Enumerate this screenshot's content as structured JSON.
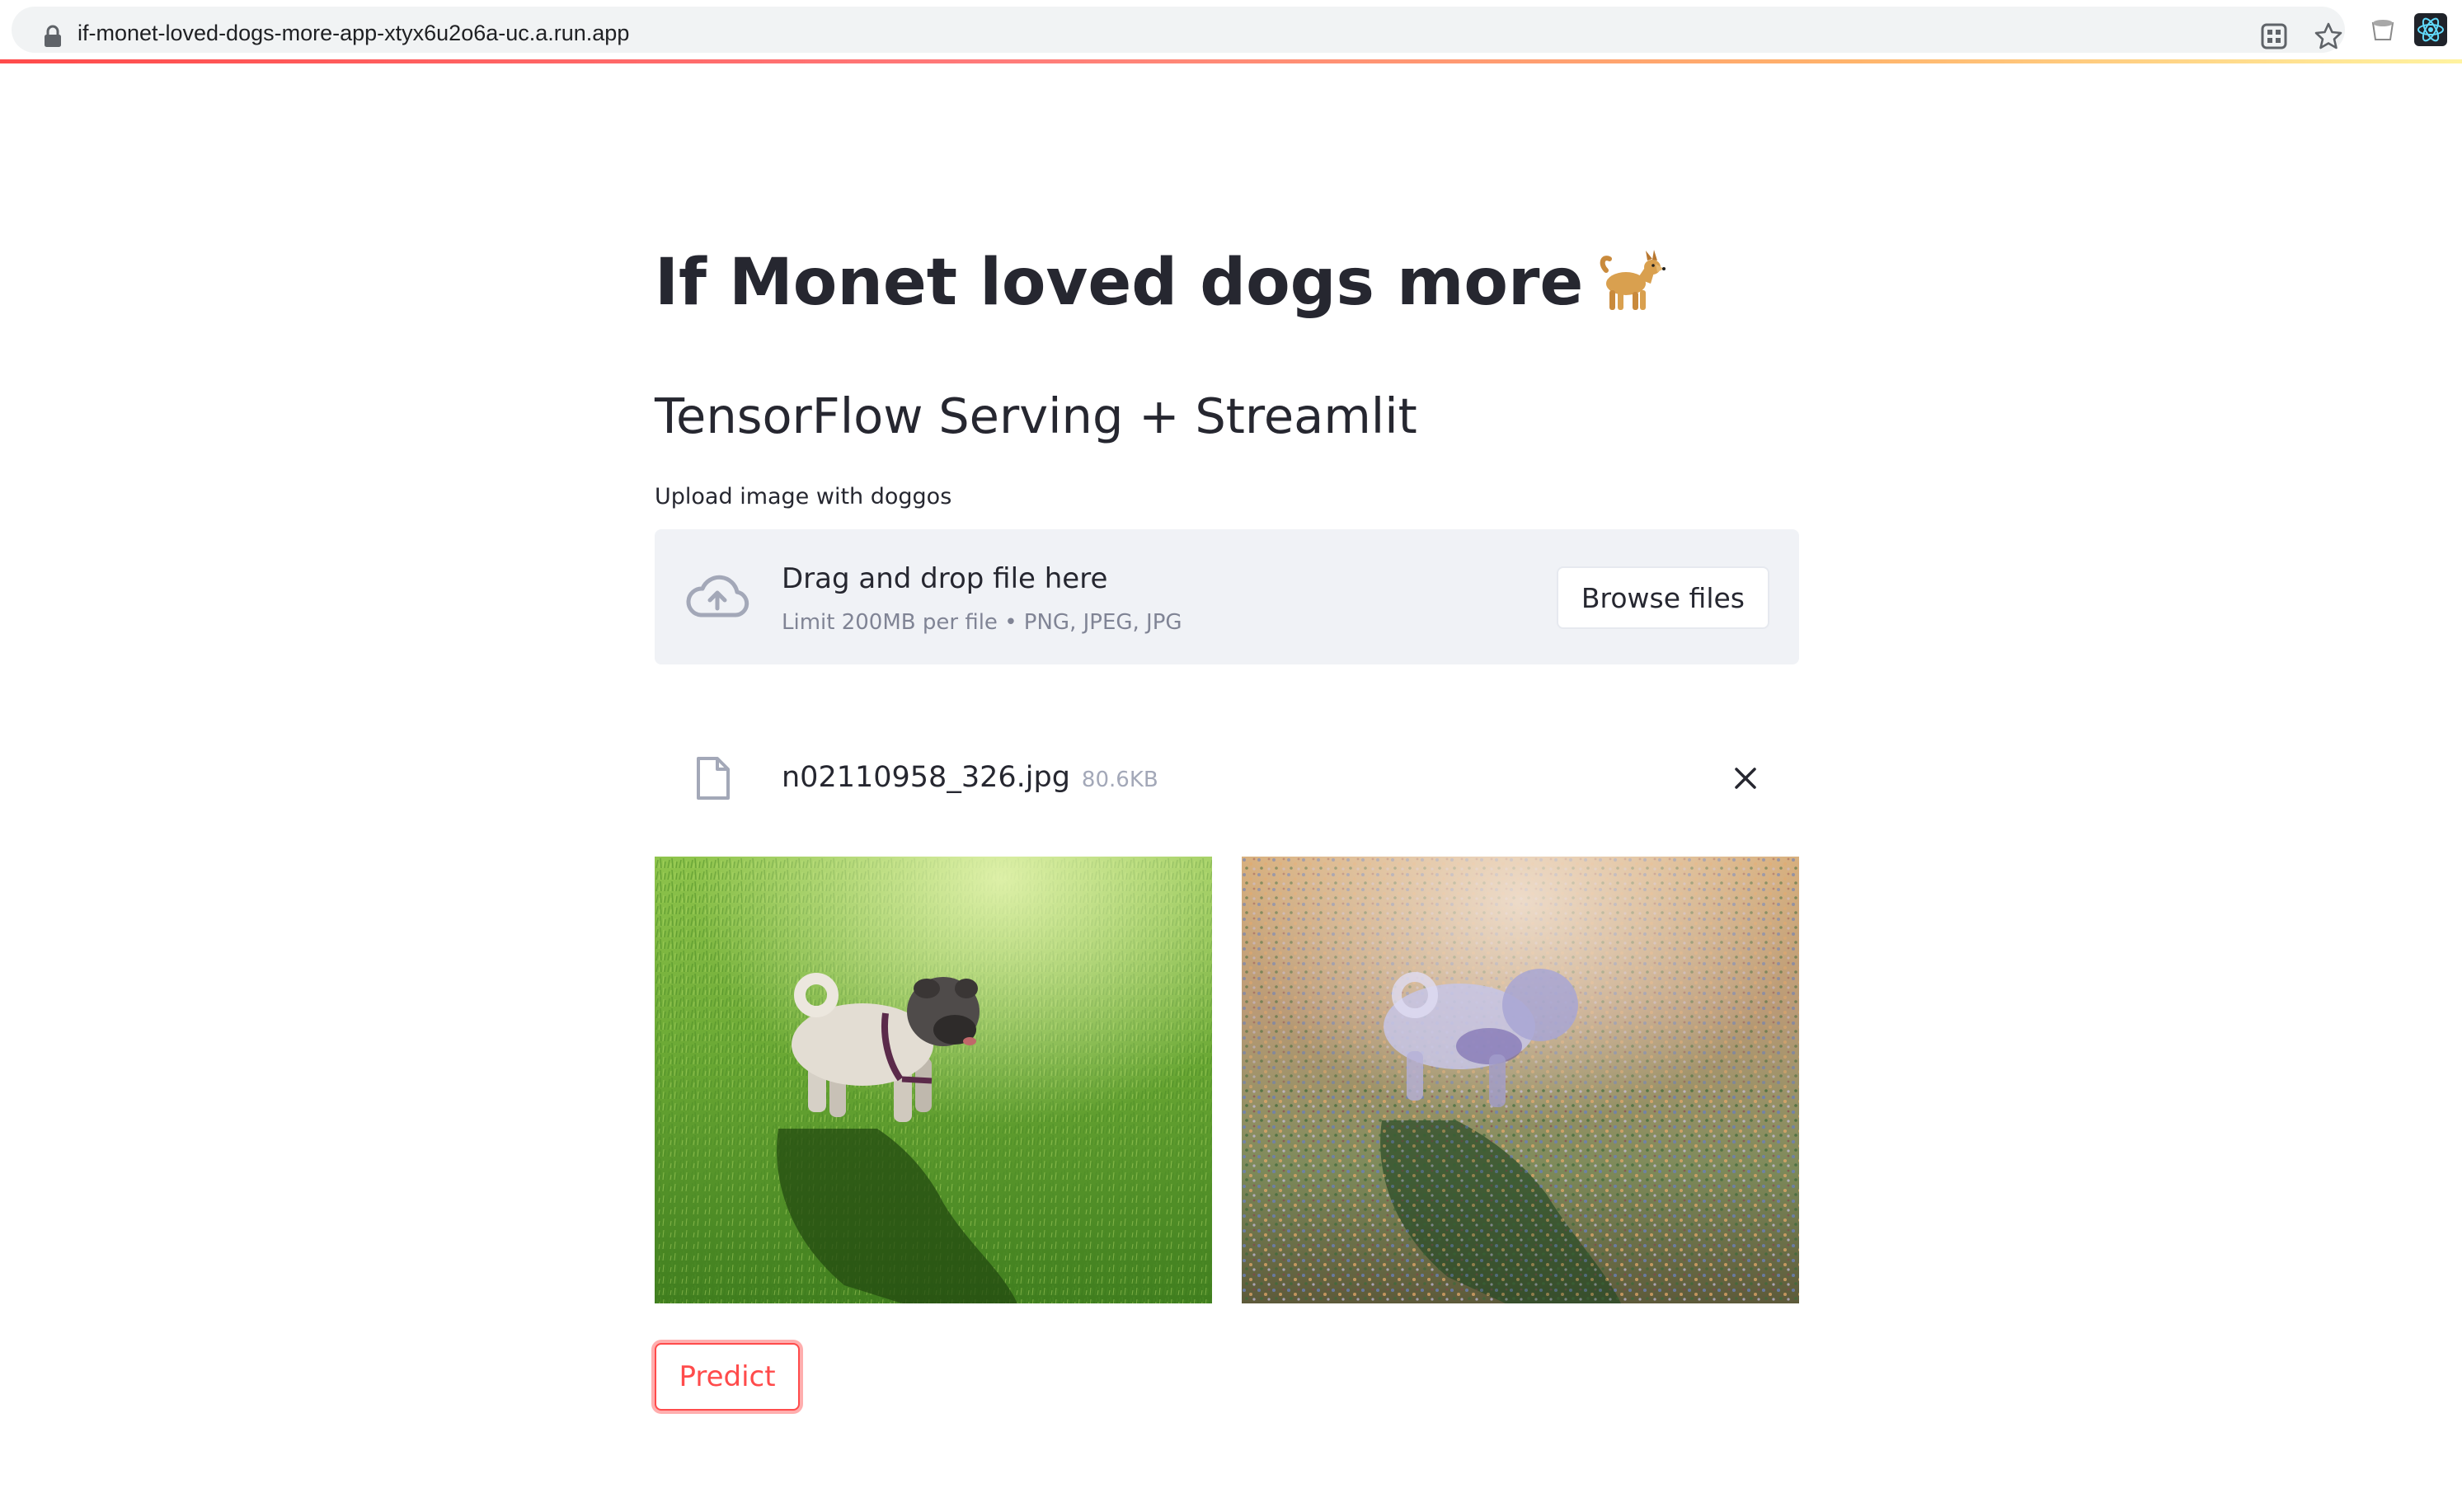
{
  "browser": {
    "url": "if-monet-loved-dogs-more-app-xtyx6u2o6a-uc.a.run.app",
    "icons": [
      "lock-icon",
      "qr-code-icon",
      "star-icon",
      "extension-icon",
      "react-devtools-icon"
    ]
  },
  "app": {
    "title": "If Monet loved dogs more",
    "title_emoji": "dog-icon",
    "subtitle": "TensorFlow Serving + Streamlit",
    "uploader": {
      "label": "Upload image with doggos",
      "drop_text": "Drag and drop file here",
      "limit_text": "Limit 200MB per file • PNG, JPEG, JPG",
      "browse_label": "Browse files",
      "icon": "cloud-upload-icon"
    },
    "uploaded_file": {
      "name": "n02110958_326.jpg",
      "size": "80.6KB",
      "icon": "file-icon",
      "remove_icon": "close-icon"
    },
    "images": {
      "input_image": "pug-photo",
      "output_image": "monet-style-pug"
    },
    "predict_label": "Predict",
    "accent_color": "#ff4b4b"
  }
}
